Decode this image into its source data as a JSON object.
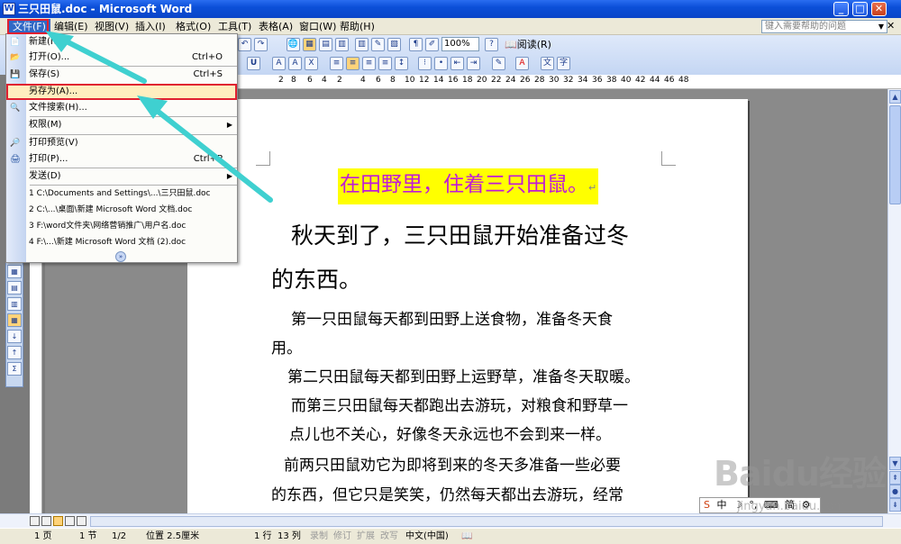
{
  "window": {
    "title": "三只田鼠.doc - Microsoft Word",
    "minimize": "_",
    "maximize": "□",
    "close": "✕"
  },
  "menubar": {
    "items": [
      "文件(F)",
      "编辑(E)",
      "视图(V)",
      "插入(I)",
      "格式(O)",
      "工具(T)",
      "表格(A)",
      "窗口(W)",
      "帮助(H)"
    ],
    "help_placeholder": "键入需要帮助的问题"
  },
  "toolbar": {
    "zoom": "100%",
    "read_label": "阅读(R)"
  },
  "ruler": {
    "marks": [
      "8",
      "6",
      "4",
      "2",
      "2",
      "4",
      "6",
      "8",
      "10",
      "12",
      "14",
      "16",
      "18",
      "20",
      "22",
      "24",
      "26",
      "28",
      "30",
      "32",
      "34",
      "36",
      "38",
      "40",
      "42",
      "44",
      "46",
      "48"
    ]
  },
  "file_menu": {
    "items": [
      {
        "label": "新建(N)...",
        "shortcut": "",
        "icon": "new-icon"
      },
      {
        "label": "打开(O)...",
        "shortcut": "Ctrl+O",
        "icon": "open-icon"
      },
      {
        "label": "保存(S)",
        "shortcut": "Ctrl+S",
        "icon": "save-icon"
      },
      {
        "label": "另存为(A)...",
        "shortcut": "",
        "icon": "",
        "selected": true
      },
      {
        "label": "文件搜索(H)...",
        "shortcut": "",
        "icon": "search-icon"
      },
      {
        "label": "权限(M)",
        "shortcut": "",
        "icon": "",
        "submenu": true
      },
      {
        "label": "打印预览(V)",
        "shortcut": "",
        "icon": "print-preview-icon"
      },
      {
        "label": "打印(P)...",
        "shortcut": "Ctrl+P",
        "icon": "print-icon"
      },
      {
        "label": "发送(D)",
        "shortcut": "",
        "icon": "",
        "submenu": true
      },
      {
        "label": "1 C:\\Documents and Settings\\...\\三只田鼠.doc",
        "shortcut": "",
        "icon": ""
      },
      {
        "label": "2 C:\\...\\桌面\\新建 Microsoft Word 文档.doc",
        "shortcut": "",
        "icon": ""
      },
      {
        "label": "3 F:\\word文件夹\\网络营销推广\\用户名.doc",
        "shortcut": "",
        "icon": ""
      },
      {
        "label": "4 F:\\...\\新建 Microsoft Word 文档 (2).doc",
        "shortcut": "",
        "icon": ""
      }
    ]
  },
  "document": {
    "title": "在田野里，住着三只田鼠。",
    "lines": [
      "秋天到了，三只田鼠开始准备过冬",
      "的东西。",
      "第一只田鼠每天都到田野上送食物，准备冬天食",
      "用。",
      "第二只田鼠每天都到田野上运野草，准备冬天取暖。",
      "而第三只田鼠每天都跑出去游玩，对粮食和野草一",
      "点儿也不关心，好像冬天永远也不会到来一样。",
      "前两只田鼠劝它为即将到来的冬天多准备一些必要",
      "的东西，但它只是笑笑，仍然每天都出去游玩，经常"
    ],
    "paragraph_mark": "↵"
  },
  "statusbar": {
    "page": "1 页",
    "section": "1 节",
    "page_of": "1/2",
    "position": "位置 2.5厘米",
    "line": "1 行",
    "column": "13 列",
    "rec": "录制",
    "trk": "修订",
    "ext": "扩展",
    "ovr": "改写",
    "language": "中文(中国)"
  },
  "ime": {
    "items": [
      "中",
      "☽",
      "°,",
      "简"
    ]
  },
  "watermark": {
    "brand": "Baidu经验",
    "url": "jingyan.baidu.com"
  },
  "colors": {
    "title_bar": "#0b4fd8",
    "highlight": "#ffff00",
    "title_text": "#c01ad8",
    "annotation": "#e02030",
    "arrow": "#3fd0d0"
  }
}
